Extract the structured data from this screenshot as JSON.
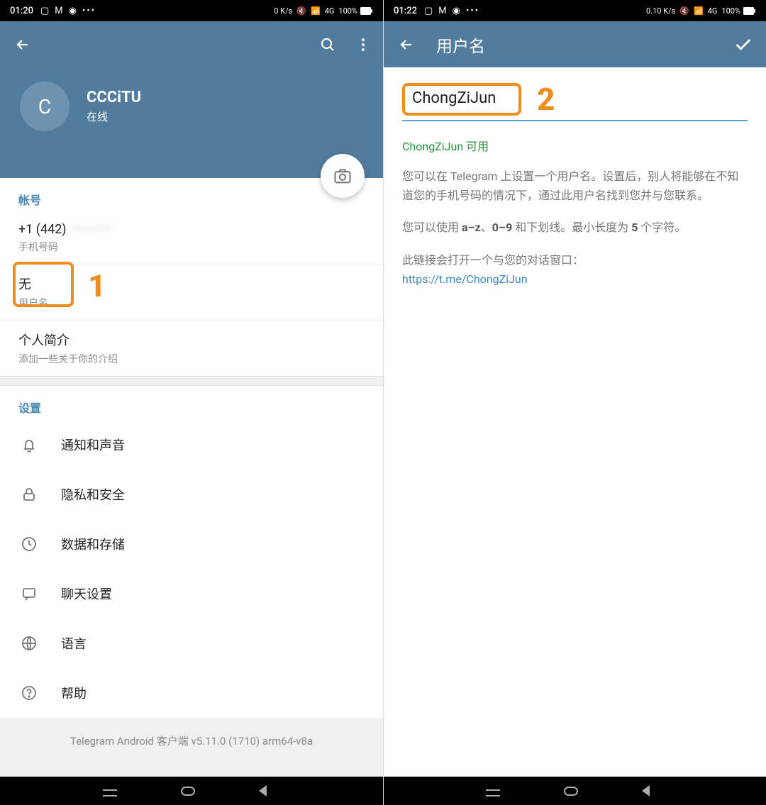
{
  "left": {
    "statusbar": {
      "time": "01:20",
      "speed": "0 K/s",
      "net": "4G",
      "battery": "100%"
    },
    "profile": {
      "initial": "C",
      "name": "CCCiTU",
      "status": "在线"
    },
    "account_header": "帐号",
    "phone": {
      "prefix": "+1 (442)",
      "rest": "••••••••",
      "label": "手机号码"
    },
    "username": {
      "value": "无",
      "label": "用户名"
    },
    "bio": {
      "value": "个人简介",
      "label": "添加一些关于你的介绍"
    },
    "settings_header": "设置",
    "settings": [
      {
        "label": "通知和声音",
        "icon": "bell-icon"
      },
      {
        "label": "隐私和安全",
        "icon": "lock-icon"
      },
      {
        "label": "数据和存储",
        "icon": "clock-icon"
      },
      {
        "label": "聊天设置",
        "icon": "chat-icon"
      },
      {
        "label": "语言",
        "icon": "globe-icon"
      },
      {
        "label": "帮助",
        "icon": "help-icon"
      }
    ],
    "version": "Telegram Android 客户端 v5.11.0 (1710) arm64-v8a",
    "annotation": "1"
  },
  "right": {
    "statusbar": {
      "time": "01:22",
      "speed": "0.10 K/s",
      "net": "4G",
      "battery": "100%"
    },
    "header_title": "用户名",
    "input_value": "ChongZiJun",
    "available": "ChongZiJun 可用",
    "desc1": "您可以在 Telegram 上设置一个用户名。设置后，别人将能够在不知道您的手机号码的情况下，通过此用户名找到您并与您联系。",
    "desc2_pre": "您可以使用 ",
    "desc2_b1": "a–z",
    "desc2_mid1": "、",
    "desc2_b2": "0–9",
    "desc2_mid2": " 和下划线。最小长度为 ",
    "desc2_b3": "5",
    "desc2_end": " 个字符。",
    "link_intro": "此链接会打开一个与您的对话窗口：",
    "link": "https://t.me/ChongZiJun",
    "annotation": "2"
  }
}
